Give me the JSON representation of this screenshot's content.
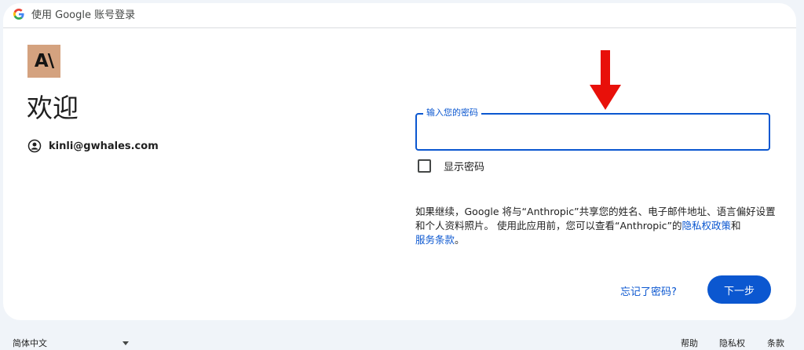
{
  "header": {
    "title": "使用 Google 账号登录"
  },
  "app": {
    "logo_text": "A\\",
    "logo_color": "#d4a27f"
  },
  "main": {
    "welcome": "欢迎",
    "account_email": "kinli@gwhales.com",
    "account_icon": "account-circle-icon"
  },
  "password": {
    "label": "输入您的密码",
    "value": "",
    "show_password_label": "显示密码",
    "show_password_checked": false
  },
  "disclaimer": {
    "text": "如果继续，Google 将与“Anthropic”共享您的姓名、电子邮件地址、语言偏好设置和个人资料照片。 使用此应用前，您可以查看“Anthropic”的",
    "privacy_link": "隐私权政策",
    "conjunction": "和",
    "terms_link": "服务条款",
    "end": "。"
  },
  "actions": {
    "forgot_password": "忘记了密码?",
    "next": "下一步"
  },
  "footer": {
    "language": "简体中文",
    "help": "帮助",
    "privacy": "隐私权",
    "terms": "条款"
  },
  "colors": {
    "accent": "#0b57d0",
    "annotation_arrow": "#e8100a"
  }
}
